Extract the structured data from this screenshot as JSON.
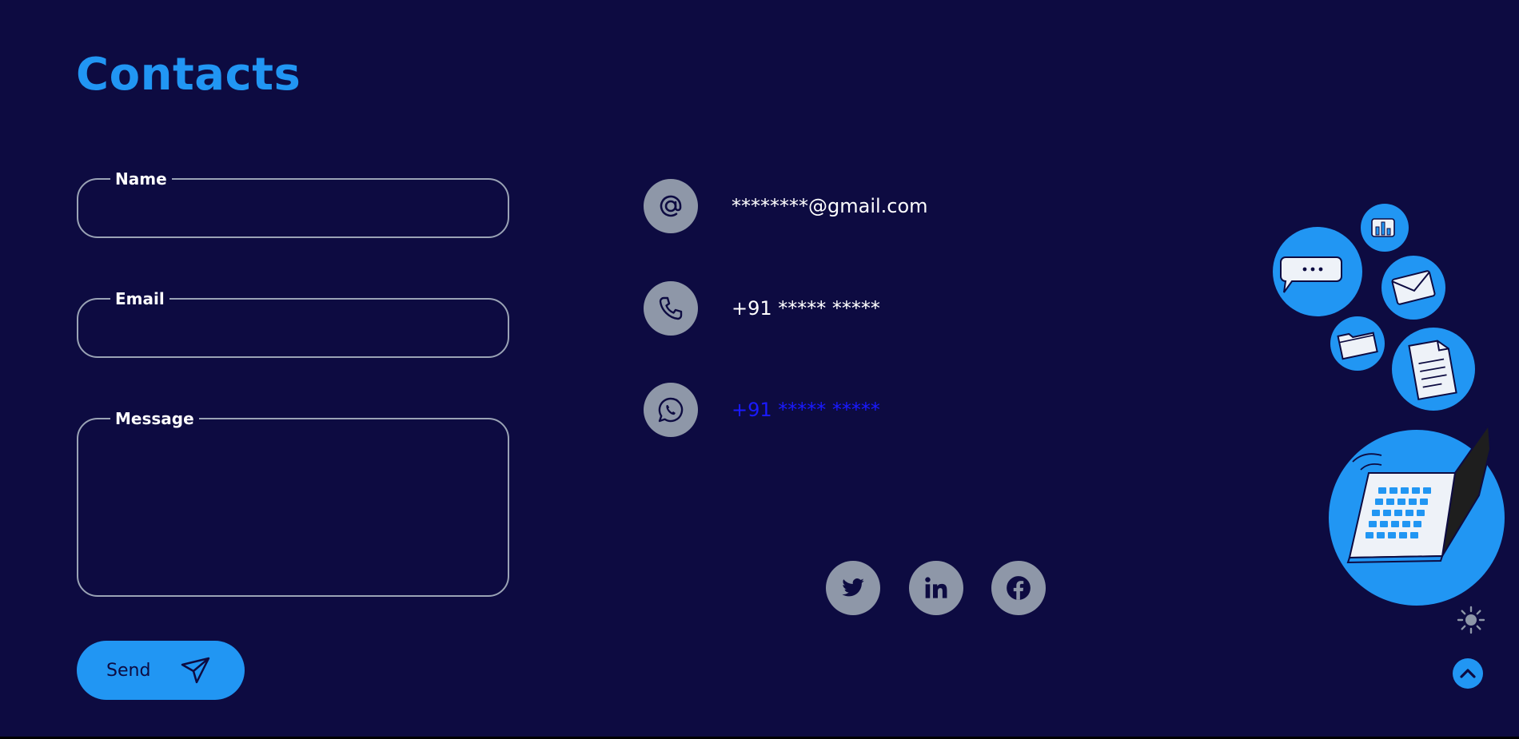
{
  "page": {
    "title": "Contacts"
  },
  "form": {
    "name_label": "Name",
    "name_value": "",
    "email_label": "Email",
    "email_value": "",
    "message_label": "Message",
    "message_value": "",
    "send_label": "Send"
  },
  "contacts": {
    "email": "********@gmail.com",
    "phone": "+91 ***** *****",
    "whatsapp": "+91 ***** *****"
  },
  "icons": {
    "email": "at-icon",
    "phone": "phone-icon",
    "whatsapp": "whatsapp-icon",
    "social": [
      "twitter-icon",
      "linkedin-icon",
      "facebook-icon"
    ],
    "theme": "sun-icon",
    "scroll_top": "chevron-up-icon"
  },
  "colors": {
    "background": "#0d0b41",
    "accent": "#2196f3",
    "icon_circle": "#8e97a8",
    "link": "#1a1aff"
  }
}
